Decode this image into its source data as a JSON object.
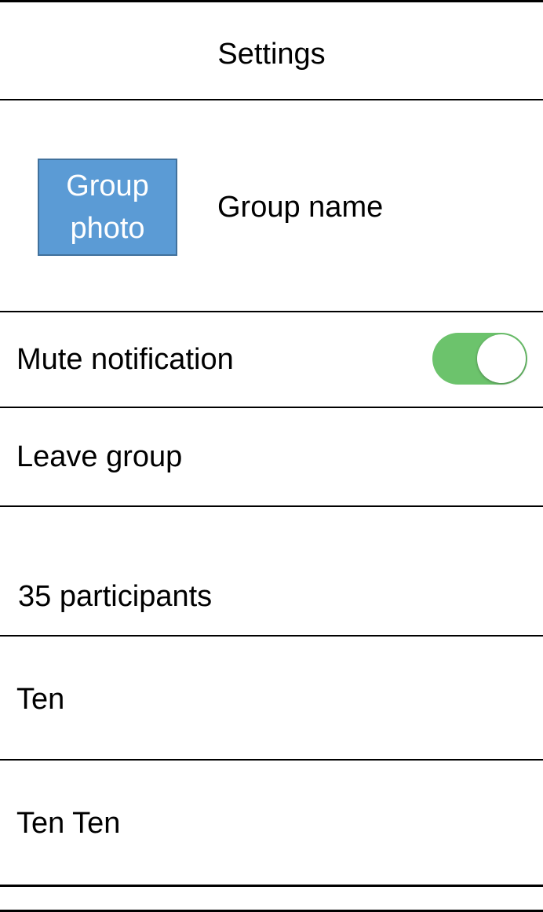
{
  "header": {
    "title": "Settings"
  },
  "group": {
    "photo_label": "Group photo",
    "name": "Group name"
  },
  "settings": {
    "mute_label": "Mute notification",
    "mute_on": true,
    "leave_label": "Leave group"
  },
  "participants": {
    "count_label": "35 participants",
    "items": [
      {
        "name": "Ten"
      },
      {
        "name": "Ten Ten"
      }
    ]
  },
  "colors": {
    "photo_fill": "#5b9bd5",
    "photo_border": "#41719c",
    "toggle_on": "#6cc36c",
    "border": "#000000"
  }
}
